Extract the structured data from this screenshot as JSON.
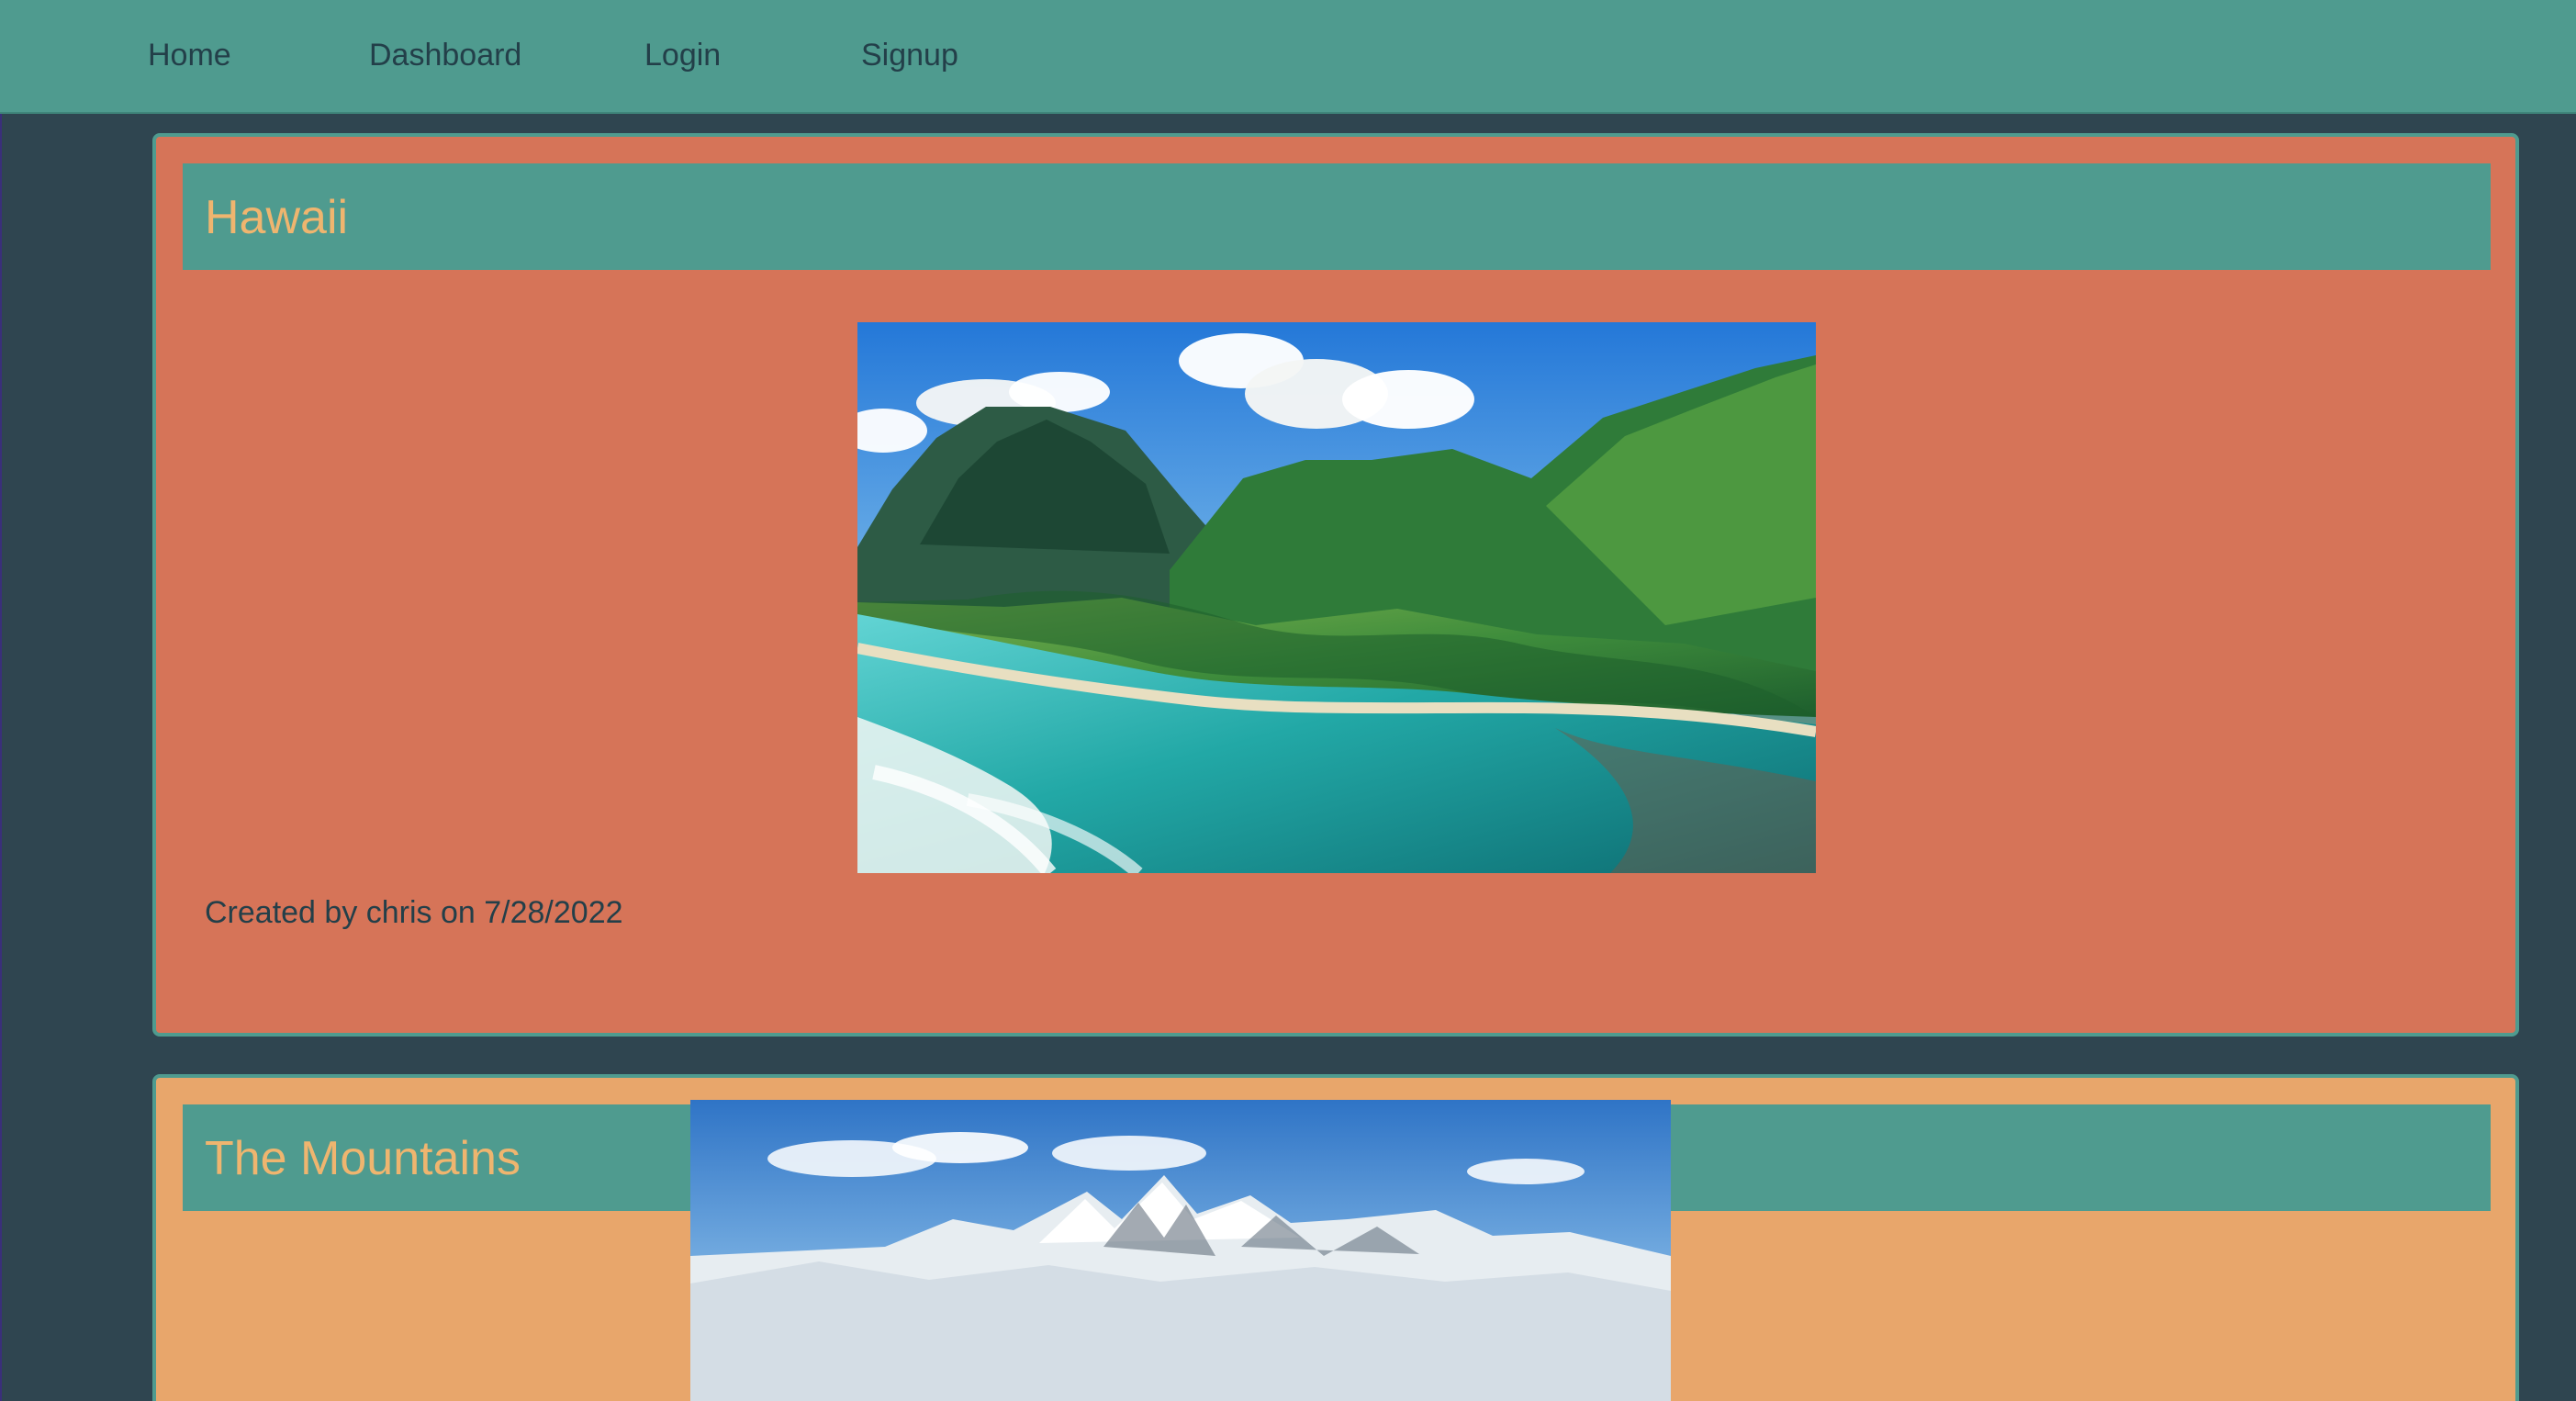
{
  "navigation": {
    "links": [
      {
        "label": "Home"
      },
      {
        "label": "Dashboard"
      },
      {
        "label": "Login"
      },
      {
        "label": "Signup"
      }
    ]
  },
  "posts": [
    {
      "title": "Hawaii",
      "image_alt": "Hawaii",
      "meta": "Created by chris on 7/28/2022",
      "background": "#d67458"
    },
    {
      "title": "The Mountains",
      "image_alt": "The Mountains",
      "background": "#e8a66b"
    }
  ],
  "theme": {
    "page_background": "#2f4550",
    "navbar_background": "#4f9b8f",
    "title_color": "#efb56f",
    "text_color": "#233f49"
  }
}
